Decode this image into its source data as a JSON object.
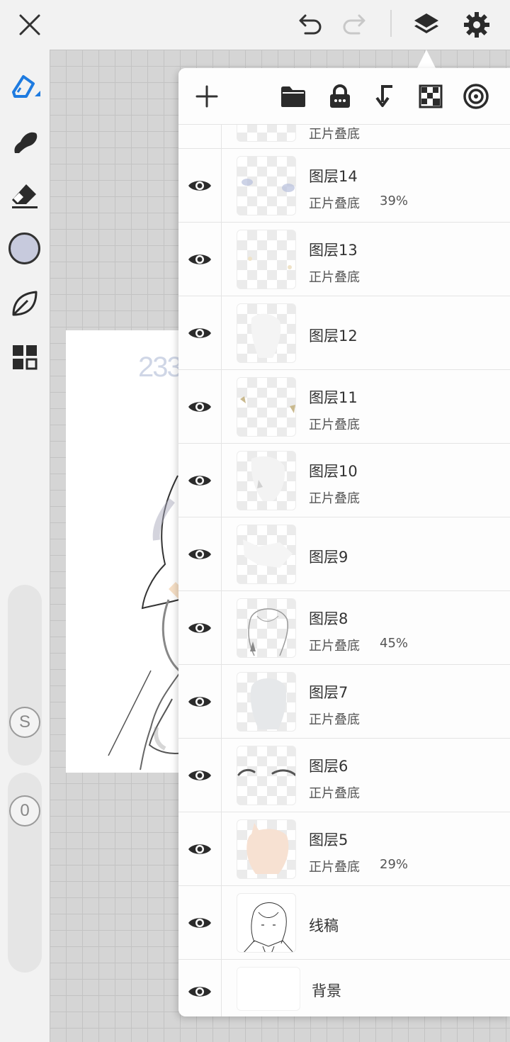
{
  "toolbar": {
    "icons": [
      "close-icon",
      "undo-icon",
      "redo-icon",
      "layers-icon",
      "gear-icon"
    ]
  },
  "left_tools": {
    "icons": [
      "pen-icon",
      "blur-brush-icon",
      "eraser-icon",
      "color-swatch",
      "leaf-icon",
      "grid-icon"
    ],
    "color": "#c7cadd",
    "size_slider_label": "S",
    "opacity_slider_label": "0"
  },
  "canvas": {
    "text": "233"
  },
  "layer_panel": {
    "actions": [
      "add-layer-icon",
      "folder-icon",
      "lock-icon",
      "merge-down-icon",
      "checker-icon",
      "target-icon"
    ],
    "partial_top_blend": "正片叠底",
    "layers": [
      {
        "name": "图层14",
        "blend": "正片叠底",
        "opacity": "39%"
      },
      {
        "name": "图层13",
        "blend": "正片叠底",
        "opacity": ""
      },
      {
        "name": "图层12",
        "blend": "",
        "opacity": ""
      },
      {
        "name": "图层11",
        "blend": "正片叠底",
        "opacity": ""
      },
      {
        "name": "图层10",
        "blend": "正片叠底",
        "opacity": ""
      },
      {
        "name": "图层9",
        "blend": "",
        "opacity": ""
      },
      {
        "name": "图层8",
        "blend": "正片叠底",
        "opacity": "45%"
      },
      {
        "name": "图层7",
        "blend": "正片叠底",
        "opacity": ""
      },
      {
        "name": "图层6",
        "blend": "正片叠底",
        "opacity": ""
      },
      {
        "name": "图层5",
        "blend": "正片叠底",
        "opacity": "29%"
      },
      {
        "name": "线稿",
        "blend": "",
        "opacity": ""
      },
      {
        "name": "背景",
        "blend": "",
        "opacity": ""
      }
    ]
  }
}
